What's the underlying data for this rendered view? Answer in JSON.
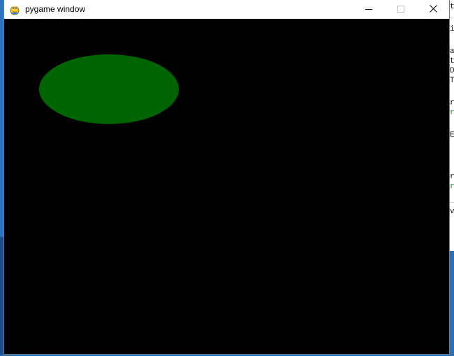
{
  "window": {
    "title": "pygame window",
    "app_icon": "pygame-snake-icon",
    "controls": {
      "minimize_icon": "minimize-icon",
      "maximize_icon": "maximize-icon",
      "close_icon": "close-icon"
    }
  },
  "canvas": {
    "background_color": "#000000",
    "ellipse_color": "#006400"
  },
  "background_editor": {
    "lines": [
      "t",
      "i",
      "a",
      "t",
      "D",
      "T",
      "r",
      "r",
      "E",
      "r",
      "r",
      "v"
    ]
  }
}
